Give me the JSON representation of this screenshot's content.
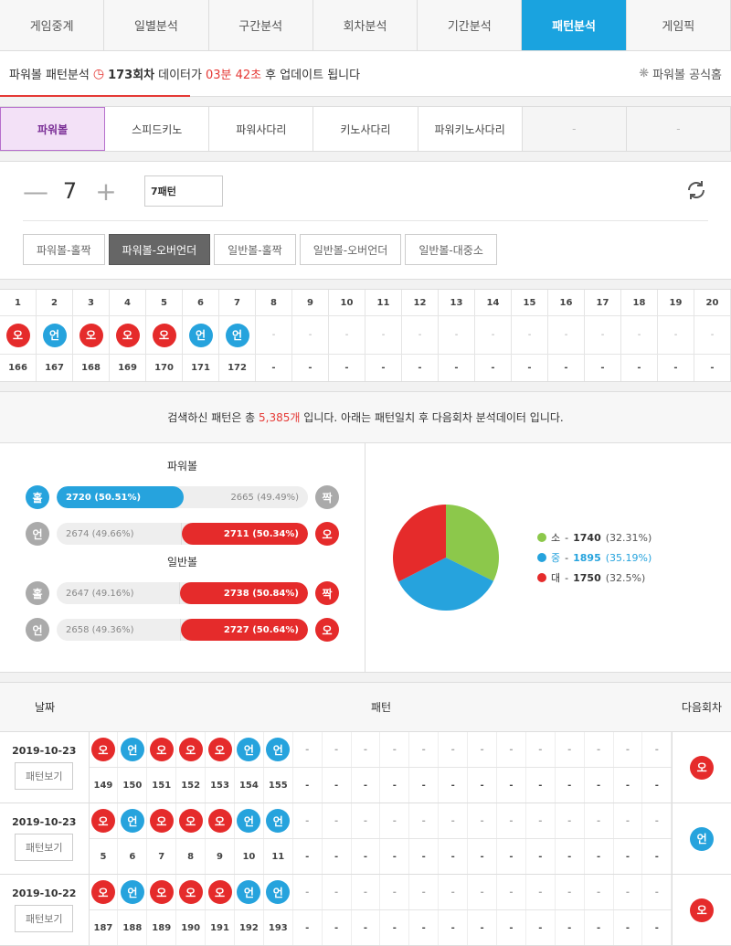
{
  "topnav": [
    "게임중계",
    "일별분석",
    "구간분석",
    "회차분석",
    "기간분석",
    "패턴분석",
    "게임픽"
  ],
  "info": {
    "prefix": "파워볼 패턴분석",
    "round": "173회차",
    "middle": "데이터가",
    "time": "03분 42초",
    "suffix": "후 업데이트 됩니다",
    "link": "파워볼 공식홈"
  },
  "gametabs": [
    "파워볼",
    "스피드키노",
    "파워사다리",
    "키노사다리",
    "파워키노사다리",
    "-",
    "-"
  ],
  "controls": {
    "count": "7",
    "input_value": "7패턴",
    "buttons": [
      "파워볼-홀짝",
      "파워볼-오버언더",
      "일반볼-홀짝",
      "일반볼-오버언더",
      "일반볼-대중소"
    ]
  },
  "pattern": {
    "headers": [
      "1",
      "2",
      "3",
      "4",
      "5",
      "6",
      "7",
      "8",
      "9",
      "10",
      "11",
      "12",
      "13",
      "14",
      "15",
      "16",
      "17",
      "18",
      "19",
      "20"
    ],
    "balls": [
      "오",
      "언",
      "오",
      "오",
      "오",
      "언",
      "언",
      "-",
      "-",
      "-",
      "-",
      "-",
      "-",
      "-",
      "-",
      "-",
      "-",
      "-",
      "-",
      "-"
    ],
    "rounds": [
      "166",
      "167",
      "168",
      "169",
      "170",
      "171",
      "172",
      "-",
      "-",
      "-",
      "-",
      "-",
      "-",
      "-",
      "-",
      "-",
      "-",
      "-",
      "-",
      "-"
    ]
  },
  "summary": {
    "pre": "검색하신 패턴은 총",
    "count": "5,385개",
    "post": "입니다. 아래는 패턴일치 후 다음회차 분석데이터 입니다."
  },
  "stats": {
    "powerball_title": "파워볼",
    "normal_title": "일반볼",
    "rows": [
      {
        "left_icon": "홀",
        "left_color": "blue",
        "left": "2720 (50.51%)",
        "right": "2665 (49.49%)",
        "right_icon": "짝",
        "right_color": "gray",
        "win": "left",
        "pct": 50.51
      },
      {
        "left_icon": "언",
        "left_color": "gray",
        "left": "2674 (49.66%)",
        "right": "2711 (50.34%)",
        "right_icon": "오",
        "right_color": "red",
        "win": "right",
        "pct": 50.34
      },
      {
        "left_icon": "홀",
        "left_color": "gray",
        "left": "2647 (49.16%)",
        "right": "2738 (50.84%)",
        "right_icon": "짝",
        "right_color": "red",
        "win": "right",
        "pct": 50.84
      },
      {
        "left_icon": "언",
        "left_color": "gray",
        "left": "2658 (49.36%)",
        "right": "2727 (50.64%)",
        "right_icon": "오",
        "right_color": "red",
        "win": "right",
        "pct": 50.64
      }
    ]
  },
  "chart_data": {
    "type": "pie",
    "categories": [
      "소",
      "중",
      "대"
    ],
    "values": [
      1740,
      1895,
      1750
    ],
    "percents": [
      "32.31%",
      "35.19%",
      "32.5%"
    ],
    "colors": [
      "#8cc84b",
      "#26a3dd",
      "#e52b2b"
    ]
  },
  "history": {
    "headers": {
      "date": "날짜",
      "pattern": "패턴",
      "next": "다음회차"
    },
    "view_label": "패턴보기",
    "rows": [
      {
        "date": "2019-10-23",
        "balls": [
          "오",
          "언",
          "오",
          "오",
          "오",
          "언",
          "언"
        ],
        "rounds": [
          "149",
          "150",
          "151",
          "152",
          "153",
          "154",
          "155"
        ],
        "next": "오"
      },
      {
        "date": "2019-10-23",
        "balls": [
          "오",
          "언",
          "오",
          "오",
          "오",
          "언",
          "언"
        ],
        "rounds": [
          "5",
          "6",
          "7",
          "8",
          "9",
          "10",
          "11"
        ],
        "next": "언"
      },
      {
        "date": "2019-10-22",
        "balls": [
          "오",
          "언",
          "오",
          "오",
          "오",
          "언",
          "언"
        ],
        "rounds": [
          "187",
          "188",
          "189",
          "190",
          "191",
          "192",
          "193"
        ],
        "next": "오"
      }
    ]
  }
}
